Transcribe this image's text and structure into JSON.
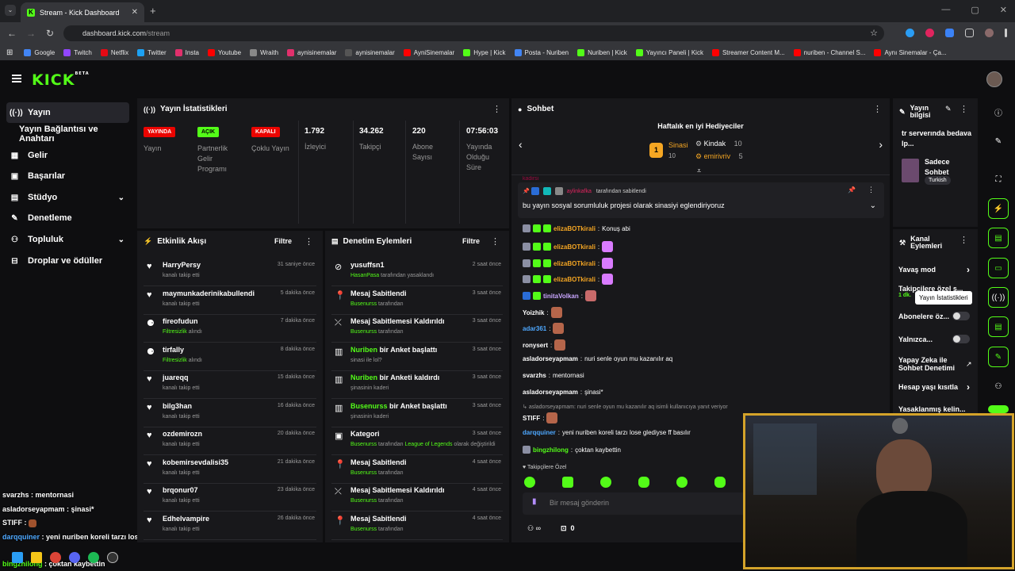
{
  "browser": {
    "tab_title": "Stream - Kick Dashboard",
    "url_host": "dashboard.kick.com",
    "url_path": "/stream",
    "bookmarks": [
      {
        "label": "Google",
        "color": "#4285f4"
      },
      {
        "label": "Twitch",
        "color": "#9146ff"
      },
      {
        "label": "Netflix",
        "color": "#e50914"
      },
      {
        "label": "Twitter",
        "color": "#1da1f2"
      },
      {
        "label": "Insta",
        "color": "#e1306c"
      },
      {
        "label": "Youtube",
        "color": "#ff0000"
      },
      {
        "label": "Wraith",
        "color": "#888888"
      },
      {
        "label": "aynisinemalar",
        "color": "#e1306c"
      },
      {
        "label": "aynisinemalar",
        "color": "#555555"
      },
      {
        "label": "AyniSinemalar",
        "color": "#ff0000"
      },
      {
        "label": "Hype | Kick",
        "color": "#53fc18"
      },
      {
        "label": "Posta - Nuriben",
        "color": "#4285f4"
      },
      {
        "label": "Nuriben | Kick",
        "color": "#53fc18"
      },
      {
        "label": "Yayıncı Paneli | Kick",
        "color": "#53fc18"
      },
      {
        "label": "Streamer Content M...",
        "color": "#ff0000"
      },
      {
        "label": "nuriben - Channel S...",
        "color": "#ff0000"
      },
      {
        "label": "Aynı Sinemalar - Ça...",
        "color": "#ff0000"
      }
    ]
  },
  "sidebar": {
    "items": [
      {
        "label": "Yayın",
        "icon": "broadcast-icon"
      },
      {
        "label": "Yayın Bağlantısı ve Anahtarı",
        "icon": ""
      },
      {
        "label": "Gelir",
        "icon": "chart-icon"
      },
      {
        "label": "Başarılar",
        "icon": "trophy-icon"
      },
      {
        "label": "Stüdyo",
        "icon": "studio-icon"
      },
      {
        "label": "Denetleme",
        "icon": "wrench-icon"
      },
      {
        "label": "Topluluk",
        "icon": "community-icon"
      },
      {
        "label": "Droplar ve ödüller",
        "icon": "gift-icon"
      }
    ]
  },
  "stats": {
    "title": "Yayın İstatistikleri",
    "items": [
      {
        "badge": "YAYINDA",
        "badge_color": "#eb0400",
        "label": "Yayın"
      },
      {
        "badge": "AÇIK",
        "badge_color": "#53fc18",
        "label": "Partnerlik Gelir Programı"
      },
      {
        "badge": "KAPALI",
        "badge_color": "#eb0400",
        "label": "Çoklu Yayın"
      },
      {
        "value": "1.792",
        "label": "İzleyici"
      },
      {
        "value": "34.262",
        "label": "Takipçi"
      },
      {
        "value": "220",
        "label": "Abone Sayısı"
      },
      {
        "value": "07:56:03",
        "label": "Yayında Olduğu Süre"
      }
    ]
  },
  "activity": {
    "title": "Etkinlik Akışı",
    "filter": "Filtre",
    "rows": [
      {
        "name": "HarryPersy",
        "sub": "kanalı takip etti",
        "time": "31 saniye önce",
        "icon": "heart-icon"
      },
      {
        "name": "maymunkaderinikabullendi",
        "sub": "kanalı takip etti",
        "time": "5 dakika önce",
        "icon": "heart-icon"
      },
      {
        "name": "fireofudun",
        "sub_green": "Filtresizlik",
        "sub": "alındı",
        "time": "7 dakika önce",
        "icon": "redeem-icon"
      },
      {
        "name": "tirfally",
        "sub_green": "Filtresizlik",
        "sub": "alındı",
        "time": "8 dakika önce",
        "icon": "redeem-icon"
      },
      {
        "name": "juareqq",
        "sub": "kanalı takip etti",
        "time": "15 dakika önce",
        "icon": "heart-icon"
      },
      {
        "name": "bilg3han",
        "sub": "kanalı takip etti",
        "time": "16 dakika önce",
        "icon": "heart-icon"
      },
      {
        "name": "ozdemirozn",
        "sub": "kanalı takip etti",
        "time": "20 dakika önce",
        "icon": "heart-icon"
      },
      {
        "name": "kobemirsevdalisi35",
        "sub": "kanalı takip etti",
        "time": "21 dakika önce",
        "icon": "heart-icon"
      },
      {
        "name": "brqonur07",
        "sub": "kanalı takip etti",
        "time": "23 dakika önce",
        "icon": "heart-icon"
      },
      {
        "name": "Edhelvampire",
        "sub": "kanalı takip etti",
        "time": "26 dakika önce",
        "icon": "heart-icon"
      }
    ]
  },
  "moderation": {
    "title": "Denetim Eylemleri",
    "filter": "Filtre",
    "rows": [
      {
        "name": "yusuffsn1",
        "sub_green": "HasanPasa",
        "sub": "tarafından yasaklandı",
        "time": "2 saat önce",
        "icon": "ban-icon"
      },
      {
        "name": "Mesaj Sabitlendi",
        "sub_green": "Busenurss",
        "sub": "tarafından",
        "time": "3 saat önce",
        "icon": "pin-icon"
      },
      {
        "name": "Mesaj Sabitlemesi Kaldırıldı",
        "sub_green": "Busenurss",
        "sub": "tarafından",
        "time": "3 saat önce",
        "icon": "unpin-icon"
      },
      {
        "name_green": "Nuriben",
        "name": "bir Anket başlattı",
        "sub": "sinasi ile lol?",
        "time": "3 saat önce",
        "icon": "poll-icon"
      },
      {
        "name_green": "Nuriben",
        "name": "bir Anketi kaldırdı",
        "sub": "şinasinin kaderi",
        "time": "3 saat önce",
        "icon": "poll-icon"
      },
      {
        "name_green": "Busenurss",
        "name": "bir Anket başlattı",
        "sub": "şinasinin kaderi",
        "time": "3 saat önce",
        "icon": "poll-icon"
      },
      {
        "name": "Kategori",
        "sub_green": "Busenurss",
        "sub": "tarafından",
        "sub_green2": "League of Legends",
        "sub3": "olarak değiştirildi",
        "time": "3 saat önce",
        "icon": "category-icon"
      },
      {
        "name": "Mesaj Sabitlendi",
        "sub_green": "Busenurss",
        "sub": "tarafından",
        "time": "4 saat önce",
        "icon": "pin-icon"
      },
      {
        "name": "Mesaj Sabitlemesi Kaldırıldı",
        "sub_green": "Busenurss",
        "sub": "tarafından",
        "time": "4 saat önce",
        "icon": "unpin-icon"
      },
      {
        "name": "Mesaj Sabitlendi",
        "sub_green": "Busenurss",
        "sub": "tarafından",
        "time": "4 saat önce",
        "icon": "pin-icon"
      }
    ]
  },
  "chat": {
    "title": "Sohbet",
    "gifters_title": "Haftalık en iyi Hediyeciler",
    "gifters": [
      {
        "rank": "1",
        "name": "Sinasi",
        "count": "10",
        "color": "#f5a623"
      },
      {
        "name": "Kindak",
        "count": "10",
        "color": "#ffffff"
      },
      {
        "name": "emirivriv",
        "count": "5",
        "color": "#f5a623"
      }
    ],
    "partial_user": "kadirsi",
    "pinned_by_user": "aylinkafka",
    "pinned_by_suffix": "tarafından sabitlendi",
    "pinned_message": "bu yayın sosyal sorumluluk projesi olarak sinasiyi eglendiriyoruz",
    "messages": [
      {
        "user": "elizaBOTkirali",
        "color": "#f5a623",
        "text": "Konuş abi"
      },
      {
        "user": "elizaBOTkirali",
        "color": "#f5a623",
        "text": ""
      },
      {
        "user": "elizaBOTkirali",
        "color": "#f5a623",
        "text": ""
      },
      {
        "user": "elizaBOTkirali",
        "color": "#f5a623",
        "text": ""
      },
      {
        "user": "tinitaVolkan",
        "color": "#c9a6ff",
        "text": ""
      },
      {
        "user": "Yoizhik",
        "color": "#ffffff",
        "text": ""
      },
      {
        "user": "adar361",
        "color": "#4ea8ff",
        "text": ""
      },
      {
        "user": "ronysert",
        "color": "#ffffff",
        "text": ""
      },
      {
        "user": "asladorseyapmam",
        "color": "#ffffff",
        "text": "nuri senle oyun mu kazanılır aq"
      },
      {
        "user": "svarzhs",
        "color": "#ffffff",
        "text": "mentornasi"
      },
      {
        "user": "asladorseyapmam",
        "color": "#ffffff",
        "text": "şinasi*"
      },
      {
        "user": "STIFF",
        "color": "#ffffff",
        "text": ""
      },
      {
        "user": "darqquiner",
        "color": "#4ea8ff",
        "text": "yeni nuriben koreli tarzı lose glediyse ff basılır"
      },
      {
        "user": "bingzhilong",
        "color": "#53fc18",
        "text": "çoktan kaybettin"
      }
    ],
    "reply_text": "asladorseyapmam: nuri senle oyun mu kazanılır aq isimli kullanıcıya yanıt veriyor",
    "followers_only": "Takipçilere Özel",
    "input_placeholder": "Bir mesaj gönderin",
    "points": "0"
  },
  "stream_info": {
    "title": "Yayın bilgisi",
    "stream_title": "tr serverında bedava lp...",
    "category": "Sadece Sohbet",
    "tag": "Turkish"
  },
  "channel_actions": {
    "title": "Kanal Eylemleri",
    "items": [
      {
        "label": "Yavaş mod",
        "type": "chevron"
      },
      {
        "label": "Takipçilere özel s...",
        "sub": "1 dk.",
        "type": "chevron"
      },
      {
        "label": "Abonelere öz...",
        "type": "toggle"
      },
      {
        "label": "Yalnızca...",
        "type": "toggle"
      },
      {
        "label": "Yapay Zeka ile Sohbet Denetimi",
        "type": "external"
      },
      {
        "label": "Hesap yaşı kısıtla",
        "type": "chevron"
      },
      {
        "label": "Yasaklanmış kelin...",
        "type": "chevron"
      }
    ]
  },
  "tooltip": "Yayın İstatistikleri",
  "overlay_chat": [
    {
      "user": "svarzhs",
      "text": "mentornasi",
      "color": "#ffffff"
    },
    {
      "user": "asladorseyapmam",
      "text": "şinasi*",
      "color": "#ffffff"
    },
    {
      "user": "STIFF",
      "text": "",
      "color": "#ffffff"
    },
    {
      "user": "darqquiner",
      "text": "yeni nuriben koreli tarzı lose gediyse ff basılır",
      "color": "#4ea8ff"
    },
    {
      "user": "bingzhilong",
      "text": "çoktan kaybettin",
      "color": "#53fc18"
    }
  ],
  "colors": {
    "accent": "#53fc18",
    "panel": "#18181b",
    "bg": "#0e0e10"
  }
}
